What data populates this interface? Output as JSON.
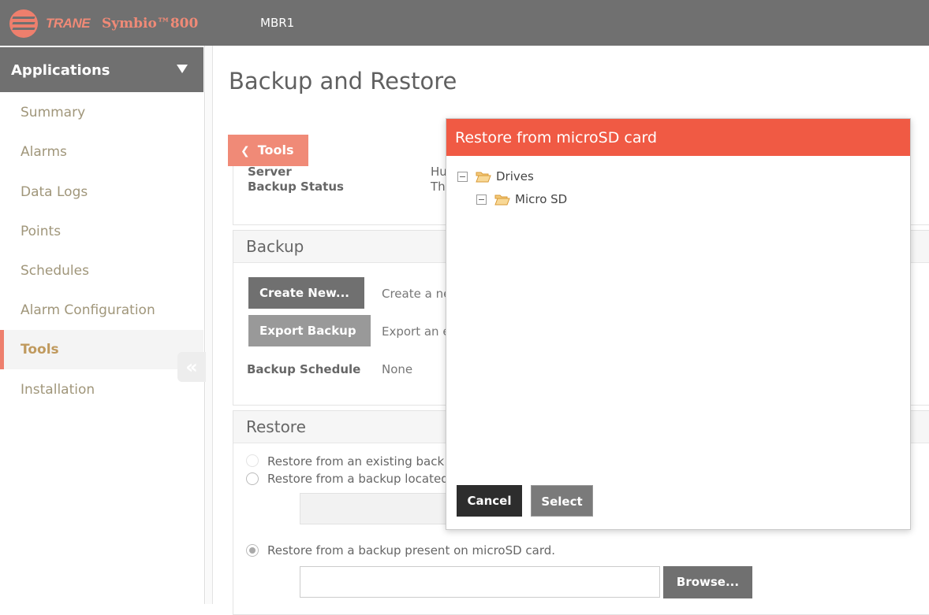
{
  "header": {
    "brand": "TRANE",
    "product": "Symbio™800",
    "device": "MBR1"
  },
  "sidebar": {
    "title": "Applications",
    "items": [
      {
        "label": "Summary"
      },
      {
        "label": "Alarms"
      },
      {
        "label": "Data Logs"
      },
      {
        "label": "Points"
      },
      {
        "label": "Schedules"
      },
      {
        "label": "Alarm Configuration"
      },
      {
        "label": "Tools",
        "active": true
      },
      {
        "label": "Installation"
      }
    ],
    "collapse_glyph": "«"
  },
  "main": {
    "title": "Backup and Restore",
    "tools_button": "Tools",
    "status": {
      "server_label": "Server",
      "server_value": "Hu",
      "backup_status_label": "Backup Status",
      "backup_status_value": "Th"
    },
    "backup": {
      "title": "Backup",
      "create_button": "Create New...",
      "create_desc": "Create a ne",
      "export_button": "Export Backup",
      "export_desc": "Export an e",
      "schedule_label": "Backup Schedule",
      "schedule_value": "None"
    },
    "restore": {
      "title": "Restore",
      "option_existing": "Restore from an existing back",
      "option_located": "Restore from a backup located",
      "option_microsd": "Restore from a backup present on microSD card.",
      "browse_button": "Browse..."
    }
  },
  "modal": {
    "title": "Restore from microSD card",
    "tree": [
      {
        "label": "Drives"
      },
      {
        "label": "Micro SD"
      }
    ],
    "cancel_button": "Cancel",
    "select_button": "Select"
  },
  "colors": {
    "accent": "#f05a44",
    "header": "#707070",
    "tools_button": "#f08a77"
  }
}
